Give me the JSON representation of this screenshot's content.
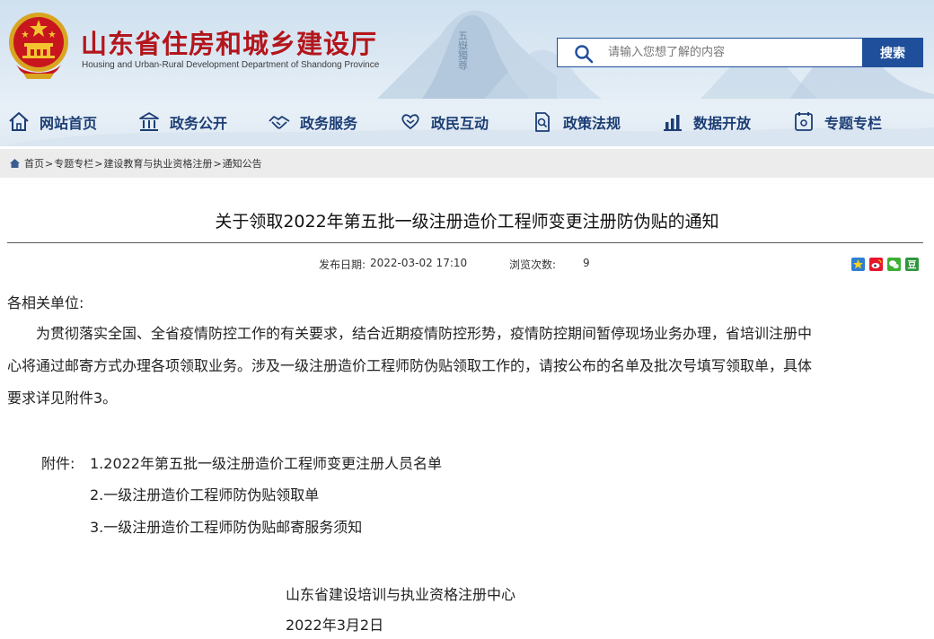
{
  "header": {
    "title": "山东省住房和城乡建设厅",
    "subtitle": "Housing and Urban-Rural Development Department of Shandong Province",
    "search": {
      "placeholder": "请输入您想了解的内容",
      "button_label": "搜索"
    }
  },
  "nav": {
    "items": [
      {
        "label": "网站首页",
        "icon": "home-icon"
      },
      {
        "label": "政务公开",
        "icon": "government-building-icon"
      },
      {
        "label": "政务服务",
        "icon": "handshake-icon"
      },
      {
        "label": "政民互动",
        "icon": "heart-hands-icon"
      },
      {
        "label": "政策法规",
        "icon": "document-search-icon"
      },
      {
        "label": "数据开放",
        "icon": "bar-chart-icon"
      },
      {
        "label": "专题专栏",
        "icon": "special-topic-icon"
      }
    ]
  },
  "breadcrumb": [
    "首页",
    "专题专栏",
    "建设教育与执业资格注册",
    "通知公告"
  ],
  "article": {
    "title": "关于领取2022年第五批一级注册造价工程师变更注册防伪贴的通知",
    "publish_label": "发布日期:",
    "publish_date": "2022-03-02 17:10",
    "views_label": "浏览次数:",
    "views": "9",
    "salutation": "各相关单位:",
    "body_lines": [
      "　　为贯彻落实全国、全省疫情防控工作的有关要求，结合近期疫情防控形势，疫情防控期间暂停现场业务办理，省培训注册中",
      "心将通过邮寄方式办理各项领取业务。涉及一级注册造价工程师防伪贴领取工作的，请按公布的名单及批次号填写领取单，具体",
      "要求详见附件3。"
    ],
    "attachments_label": "附件:",
    "attachments": [
      "1.2022年第五批一级注册造价工程师变更注册人员名单",
      "2.一级注册造价工程师防伪贴领取单",
      "3.一级注册造价工程师防伪贴邮寄服务须知"
    ],
    "signature_org": "山东省建设培训与执业资格注册中心",
    "signature_date": "2022年3月2日"
  },
  "share_icons": [
    "qzone-icon",
    "weibo-icon",
    "wechat-icon",
    "douban-icon"
  ],
  "colors": {
    "brand_red": "#b3161c",
    "nav_blue": "#1c3e75",
    "search_blue": "#1f4f9a",
    "breadcrumb_bg": "#ececec"
  }
}
